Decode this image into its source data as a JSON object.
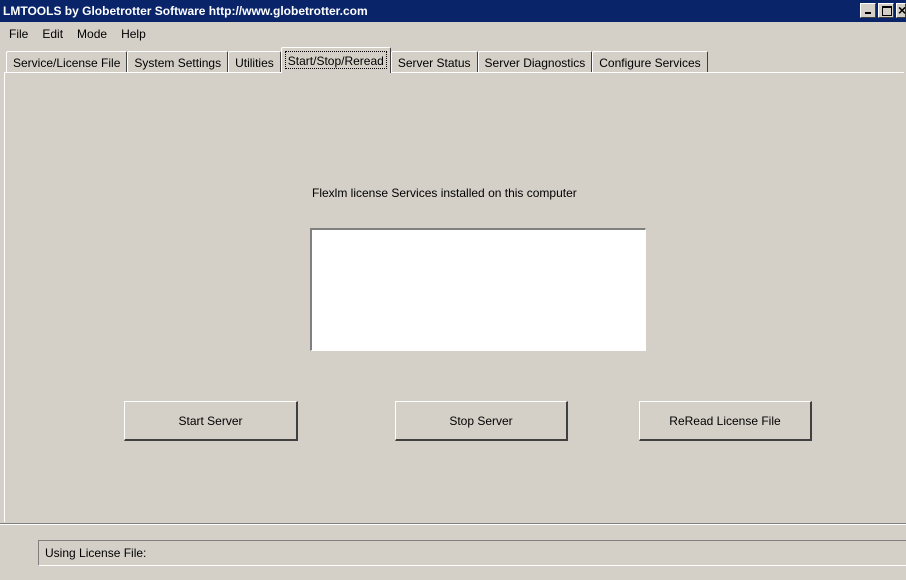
{
  "window": {
    "title": "LMTOOLS by Globetrotter Software http://www.globetrotter.com"
  },
  "menu": {
    "items": [
      "File",
      "Edit",
      "Mode",
      "Help"
    ]
  },
  "tabs": [
    {
      "label": "Service/License File",
      "active": false
    },
    {
      "label": "System Settings",
      "active": false
    },
    {
      "label": "Utilities",
      "active": false
    },
    {
      "label": "Start/Stop/Reread",
      "active": true
    },
    {
      "label": "Server Status",
      "active": false
    },
    {
      "label": "Server Diagnostics",
      "active": false
    },
    {
      "label": "Configure Services",
      "active": false
    }
  ],
  "panel": {
    "services_label": "Flexlm license Services installed on this computer",
    "services_list": []
  },
  "buttons": {
    "start": "Start Server",
    "stop": "Stop Server",
    "reread": "ReRead License File"
  },
  "status": {
    "text": "Using License File:"
  }
}
